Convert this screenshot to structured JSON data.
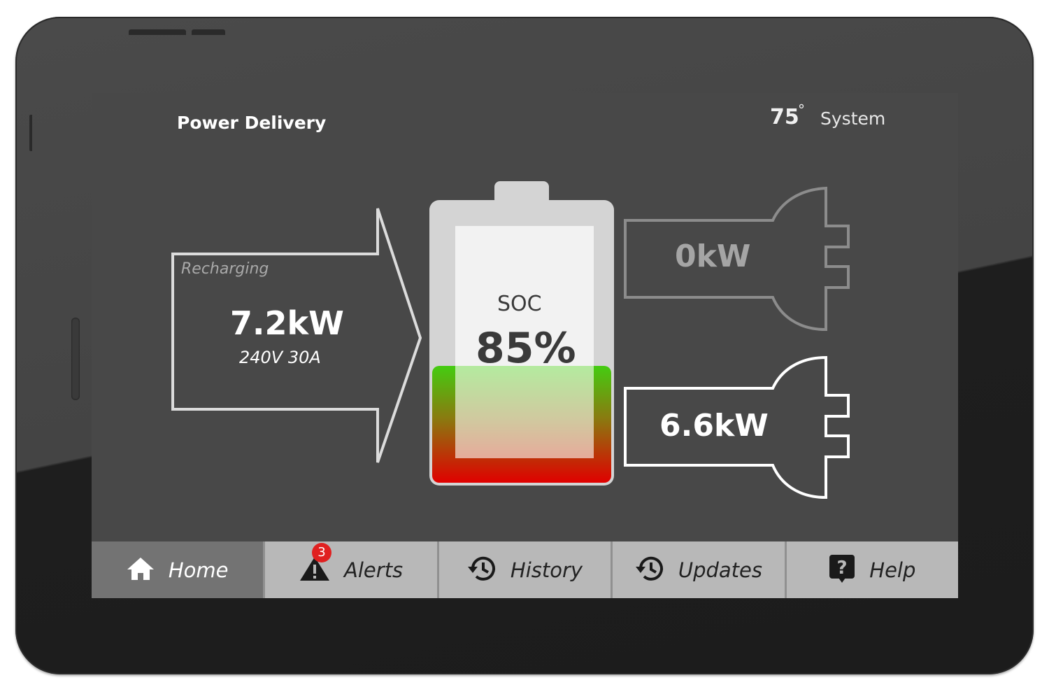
{
  "header": {
    "title": "Power Delivery",
    "temperature": "75",
    "degree_symbol": "°",
    "system_label": "System"
  },
  "input": {
    "status": "Recharging",
    "power": "7.2kW",
    "detail": "240V 30A"
  },
  "battery": {
    "label": "SOC",
    "value_text": "85%",
    "soc_percent": 85
  },
  "outputs": [
    {
      "power": "0kW",
      "active": false
    },
    {
      "power": "6.6kW",
      "active": true
    }
  ],
  "nav": {
    "tabs": [
      {
        "label": "Home",
        "icon": "home-icon",
        "active": true
      },
      {
        "label": "Alerts",
        "icon": "warning-icon",
        "badge": "3"
      },
      {
        "label": "History",
        "icon": "history-icon"
      },
      {
        "label": "Updates",
        "icon": "history-icon"
      },
      {
        "label": "Help",
        "icon": "help-icon"
      }
    ]
  },
  "colors": {
    "screen_bg": "#484848",
    "nav_bg": "#b8b8b8",
    "nav_active_bg": "#737373",
    "battery_top": "#44cc11",
    "battery_bottom": "#e00000",
    "badge": "#e02020"
  }
}
